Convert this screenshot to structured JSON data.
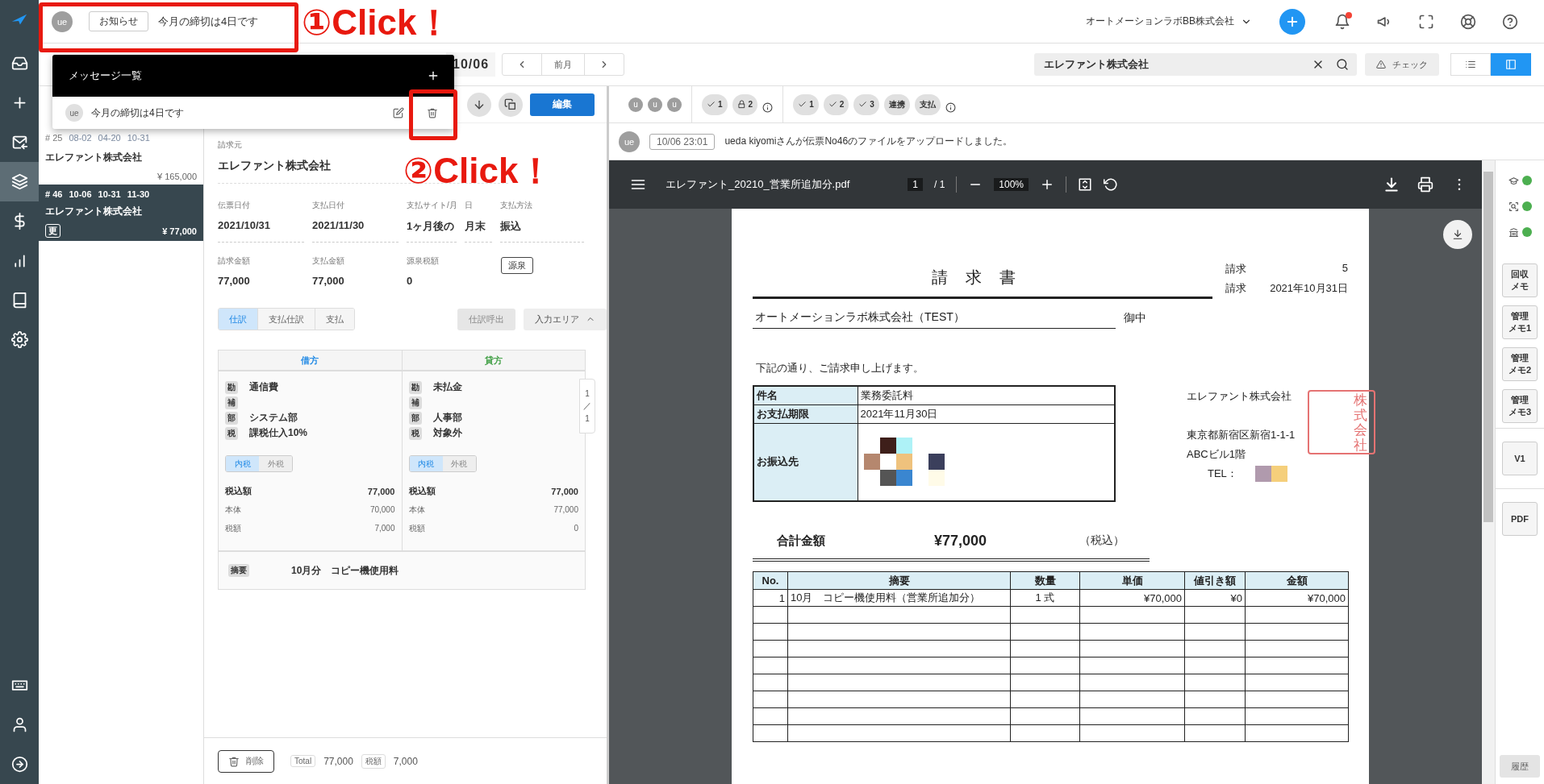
{
  "nav": {
    "items": [
      {
        "kind": "inbox",
        "selected": false
      },
      {
        "kind": "plus",
        "selected": false
      },
      {
        "kind": "mail",
        "selected": false
      },
      {
        "kind": "layers",
        "selected": true
      },
      {
        "kind": "dollar",
        "selected": false
      },
      {
        "kind": "chart",
        "selected": false
      },
      {
        "kind": "book",
        "selected": false
      },
      {
        "kind": "gear",
        "selected": false
      }
    ],
    "bottom": [
      {
        "kind": "keyboard"
      },
      {
        "kind": "user"
      },
      {
        "kind": "logout"
      }
    ]
  },
  "topbar": {
    "notice": {
      "avatar": "ue",
      "tag": "お知らせ",
      "text": "今月の締切は4日です"
    },
    "company": "オートメーションラボBB株式会社",
    "unread": true
  },
  "toolbar": {
    "date": "10/06",
    "prev_month": "前月",
    "search": {
      "value": "エレファント株式会社"
    },
    "check": "チェック",
    "views": [
      {
        "kind": "list",
        "selected": false
      },
      {
        "kind": "panel",
        "selected": true
      }
    ]
  },
  "popup": {
    "title": "メッセージ一覧",
    "items": [
      {
        "avatar": "ue",
        "text": "今月の締切は4日です"
      }
    ]
  },
  "annotations": [
    {
      "label": "①Click！"
    },
    {
      "label": "②Click！"
    }
  ],
  "list": [
    {
      "no": "# 25",
      "dates": [
        "08-02",
        "04-20",
        "10-31"
      ],
      "name": "エレファント株式会社",
      "amount": "¥ 165,000",
      "selected": false
    },
    {
      "no": "# 46",
      "dates": [
        "10-06",
        "10-31",
        "11-30"
      ],
      "name": "エレファント株式会社",
      "badge": "更",
      "amount": "¥ 77,000",
      "selected": true
    }
  ],
  "detail": {
    "edit": "編集",
    "biller_label": "請求元",
    "biller": "エレファント株式会社",
    "fields": [
      {
        "label": "伝票日付",
        "value": "2021/10/31"
      },
      {
        "label": "支払日付",
        "value": "2021/11/30"
      },
      {
        "label": "支払サイト/月",
        "value": "1ヶ月後の"
      },
      {
        "label": "日",
        "value": "月末"
      },
      {
        "label": "支払方法",
        "value": "振込"
      }
    ],
    "amounts": [
      {
        "label": "請求金額",
        "value": "77,000"
      },
      {
        "label": "支払金額",
        "value": "77,000"
      },
      {
        "label": "源泉税額",
        "value": "0"
      }
    ],
    "withholding": "源泉",
    "tabs": [
      {
        "label": "仕訳",
        "selected": true
      },
      {
        "label": "支払仕訳",
        "selected": false
      },
      {
        "label": "支払",
        "selected": false
      }
    ],
    "recall": {
      "label": "仕訳呼出",
      "disabled": true
    },
    "input_area": "入力エリア",
    "journal": {
      "sides": [
        {
          "title": "借方",
          "color": "#1e88e5",
          "rows": [
            {
              "tag": "勘",
              "value": "通信費"
            },
            {
              "tag": "補"
            },
            {
              "tag": "部",
              "value": "システム部"
            },
            {
              "tag": "税",
              "value": "課税仕入10%"
            }
          ],
          "tax_modes": [
            {
              "label": "内税",
              "selected": true
            },
            {
              "label": "外税",
              "selected": false
            }
          ],
          "totals": [
            {
              "label": "税込額",
              "value": "77,000",
              "kind": "main"
            },
            {
              "label": "本体",
              "value": "70,000",
              "kind": "sub"
            },
            {
              "label": "税額",
              "value": "7,000",
              "kind": "sub"
            }
          ]
        },
        {
          "title": "貸方",
          "color": "#43a047",
          "rows": [
            {
              "tag": "勘",
              "value": "未払金"
            },
            {
              "tag": "補"
            },
            {
              "tag": "部",
              "value": "人事部"
            },
            {
              "tag": "税",
              "value": "対象外"
            }
          ],
          "tax_modes": [
            {
              "label": "内税",
              "selected": true
            },
            {
              "label": "外税",
              "selected": false
            }
          ],
          "totals": [
            {
              "label": "税込額",
              "value": "77,000",
              "kind": "main"
            },
            {
              "label": "本体",
              "value": "77,000",
              "kind": "sub"
            },
            {
              "label": "税額",
              "value": "0",
              "kind": "sub"
            }
          ]
        }
      ],
      "pager": [
        "1",
        "／",
        "1"
      ],
      "memo_tag": "摘要",
      "memo": "10月分　コピー機使用料"
    },
    "footer": {
      "delete": "削除",
      "total_tag": "Total",
      "total": "77,000",
      "tax_tag": "税額",
      "tax": "7,000"
    }
  },
  "status": {
    "users": [
      "u",
      "u",
      "u"
    ],
    "group1": [
      {
        "kind": "check",
        "label": "1"
      },
      {
        "kind": "lock",
        "label": "2"
      }
    ],
    "group2": [
      {
        "kind": "check",
        "label": "1"
      },
      {
        "kind": "check",
        "label": "2"
      },
      {
        "kind": "check",
        "label": "3"
      },
      {
        "kind": "text",
        "label": "連携"
      },
      {
        "kind": "text",
        "label": "支払"
      }
    ]
  },
  "message": {
    "avatar": "ue",
    "time": "10/06 23:01",
    "text": "ueda kiyomiさんが伝票No46のファイルをアップロードしました。"
  },
  "pdf": {
    "filename": "エレファント_20210_営業所追加分.pdf",
    "page": "1",
    "pages": "/ 1",
    "zoom": "100%"
  },
  "document": {
    "title": "請求書",
    "meta": [
      {
        "label": "請求",
        "value": "5"
      },
      {
        "label": "請求",
        "value": "2021年10月31日"
      }
    ],
    "recipient": "オートメーションラボ株式会社（TEST）",
    "honorific": "御中",
    "intro": "下記の通り、ご請求申し上げます。",
    "info": [
      {
        "label": "件名",
        "value": "業務委託料",
        "kind": "text"
      },
      {
        "label": "お支払期限",
        "value": "2021年11月30日",
        "kind": "text"
      },
      {
        "label": "お振込先",
        "kind": "redacted"
      }
    ],
    "issuer": {
      "name": "エレファント株式会社",
      "address": "東京都新宿区新宿1-1-1",
      "building": "ABCビル1階",
      "tel_label": "TEL：",
      "stamp": "株式会社"
    },
    "total_label": "合計金額",
    "total": "¥77,000",
    "tax_note": "（税込）",
    "table": {
      "columns": [
        "No.",
        "摘要",
        "数量",
        "単価",
        "値引き額",
        "金額"
      ],
      "rows": [
        [
          "1",
          "10月　コピー機使用料（営業所追加分）",
          "1 式",
          "¥70,000",
          "¥0",
          "¥70,000"
        ]
      ]
    }
  },
  "sidebar": {
    "indicators": [
      {
        "kind": "cap",
        "color": "#4caf50"
      },
      {
        "kind": "scan",
        "color": "#4caf50"
      },
      {
        "kind": "bank",
        "color": "#4caf50"
      }
    ],
    "memos": [
      "回収メモ",
      "管理メモ1",
      "管理メモ2",
      "管理メモ3"
    ],
    "version": "V1",
    "pdf": "PDF",
    "history": "履歴"
  }
}
